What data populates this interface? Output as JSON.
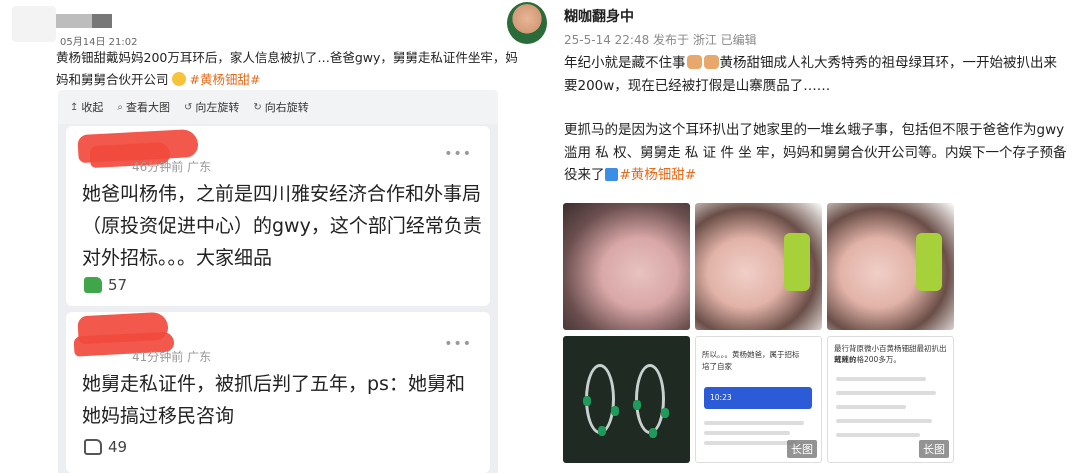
{
  "left_post": {
    "date": "05月14日 21:02",
    "text": "黄杨钿甜戴妈妈200万耳环后，家人信息被扒了…爸爸gwy，舅舅走私证件坐牢，妈妈和舅舅合伙开公司",
    "hashtag": "#黄杨钿甜#",
    "toolbar": [
      {
        "icon": "collapse-icon",
        "glyph": "↥",
        "label": "收起"
      },
      {
        "icon": "zoom-icon",
        "glyph": "⌕",
        "label": "查看大图"
      },
      {
        "icon": "rotate-left-icon",
        "glyph": "↺",
        "label": "向左旋转"
      },
      {
        "icon": "rotate-right-icon",
        "glyph": "↻",
        "label": "向右旋转"
      }
    ],
    "comments": [
      {
        "time": "46分钟前 广东",
        "text": "她爸叫杨伟，之前是四川雅安经济合作和外事局（原投资促进中心）的gwy，这个部门经常负责对外招标。。。大家细品",
        "likes": "57"
      },
      {
        "time": "41分钟前 广东",
        "text": "她舅走私证件，被抓后判了五年，ps：她舅和她妈搞过移民咨询",
        "likes": "49"
      }
    ],
    "more_glyph": "•••"
  },
  "right_post": {
    "author": "糊咖翻身中",
    "meta": "25-5-14 22:48 发布于 浙江  已编辑",
    "para1_a": "年纪小就是藏不住事",
    "para1_b": "黄杨甜钿成人礼大秀特秀的祖母绿耳环，一开始被扒出来要200w，现在已经被打假是山寨赝品了……",
    "para2": "更抓马的是因为这个耳环扒出了她家里的一堆幺蛾子事，包括但不限于爸爸作为gwy滥用 私 权、舅舅走 私 证 件 坐 牢，妈妈和舅舅合伙开公司等。内娱下一个存子预备役来了",
    "hashtag": "#黄杨钿甜#",
    "long_image_label": "长图",
    "screenshot_snippets": {
      "p5_line1": "所以。。。黄杨她爸，属于招标",
      "p5_line2": "培了自家",
      "p5_card": "10:23",
      "p6_line1": "最行背原微小百黄杨钿甜最初扒出戴戴的",
      "p6_line2": "耳环价格200多万。"
    }
  },
  "colors": {
    "hashtag": "#e86a1a",
    "redact": "#f14a3c",
    "like": "#3fa64a"
  }
}
